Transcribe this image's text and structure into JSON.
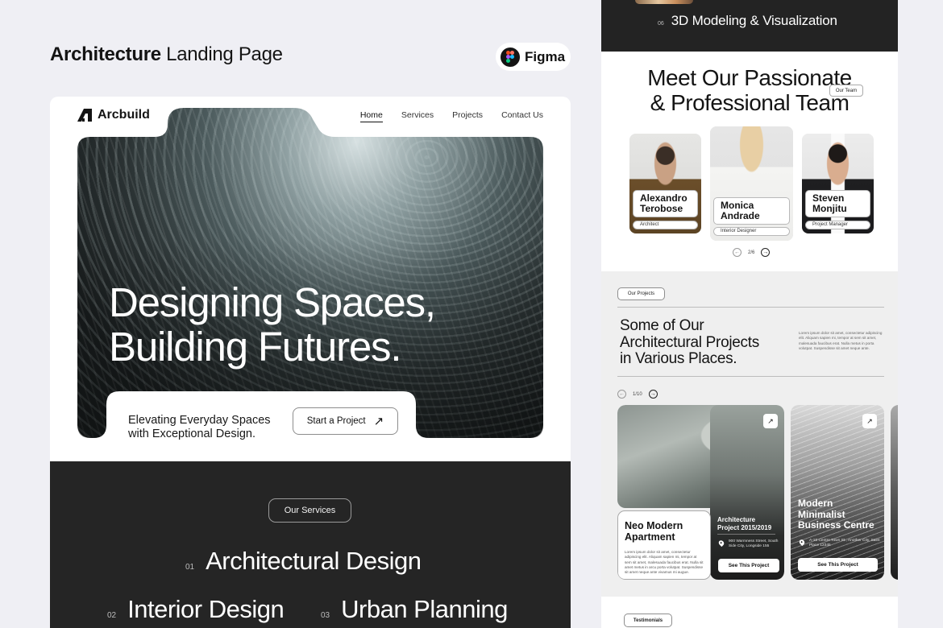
{
  "header": {
    "title_bold": "Architecture",
    "title_light": "Landing Page",
    "figma_badge": "Figma",
    "figma_colors": [
      "#f24e1e",
      "#ff7262",
      "#a259ff",
      "#1abcfe",
      "#0acf83"
    ]
  },
  "left_mockup": {
    "brand": "Arcbuild",
    "nav": [
      {
        "label": "Home",
        "active": true
      },
      {
        "label": "Services",
        "active": false
      },
      {
        "label": "Projects",
        "active": false
      },
      {
        "label": "Contact Us",
        "active": false
      }
    ],
    "hero": {
      "heading_line1": "Designing Spaces,",
      "heading_line2": "Building Futures.",
      "subtext_line1": "Elevating Everyday Spaces",
      "subtext_line2": "with Exceptional Design.",
      "cta_label": "Start a Project",
      "cta_icon": "arrow-up-right-icon"
    },
    "services": {
      "pill": "Our Services",
      "items": [
        {
          "num": "01",
          "label": "Architectural Design"
        },
        {
          "num": "02",
          "label": "Interior Design"
        },
        {
          "num": "03",
          "label": "Urban Planning"
        }
      ]
    }
  },
  "right_mockup": {
    "service_6": {
      "num": "06",
      "label": "3D Modeling & Visualization"
    },
    "team": {
      "title_line1": "Meet Our Passionate",
      "title_line2": "& Professional Team",
      "pill": "Our Team",
      "members": [
        {
          "first": "Alexandro",
          "last": "Terobose",
          "role": "Architect"
        },
        {
          "first": "Monica",
          "last": "Andrade",
          "role": "Interior Designer"
        },
        {
          "first": "Steven",
          "last": "Monjitu",
          "role": "Project Manager"
        }
      ],
      "pager": "2/6"
    },
    "projects": {
      "pill": "Our Projects",
      "title_line1": "Some of Our",
      "title_line2": "Architectural Projects",
      "title_line3": "in Various Places.",
      "description": "Lorem ipsum dolor sit amet, consectetur adipiscing elit. Aliquam sapien mi, tempor at sem sit amet, malesuada faucibus erat. Nulla metus in porta volutpat. Suspendisse sit amet neque ante.",
      "pager": "1/10",
      "cards": [
        {
          "title_line1": "Neo Modern",
          "title_line2": "Apartment",
          "description": "Lorem ipsum dolor sit amet, consectetur adipiscing elit. Aliquam sapien mi, tempor at sem sit amet, malesuada faucibus erat. Nulla sit amet metus in arcu porta volutpat. Suspendisse sit amet neque ante vivamus mi augue.",
          "subtitle_line1": "Architecture",
          "subtitle_line2": "Project 2015/2019",
          "address": "900 Warmness Street, South Side City, Longside 155",
          "button": "See This Project"
        },
        {
          "title_line1": "Modern",
          "title_line2": "Minimalist",
          "title_line3": "Business Centre",
          "address": "A-10 Centre Town St., Another City, Saint Place 12345",
          "button": "See This Project"
        }
      ]
    },
    "testimonials_pill": "Testimonials"
  }
}
